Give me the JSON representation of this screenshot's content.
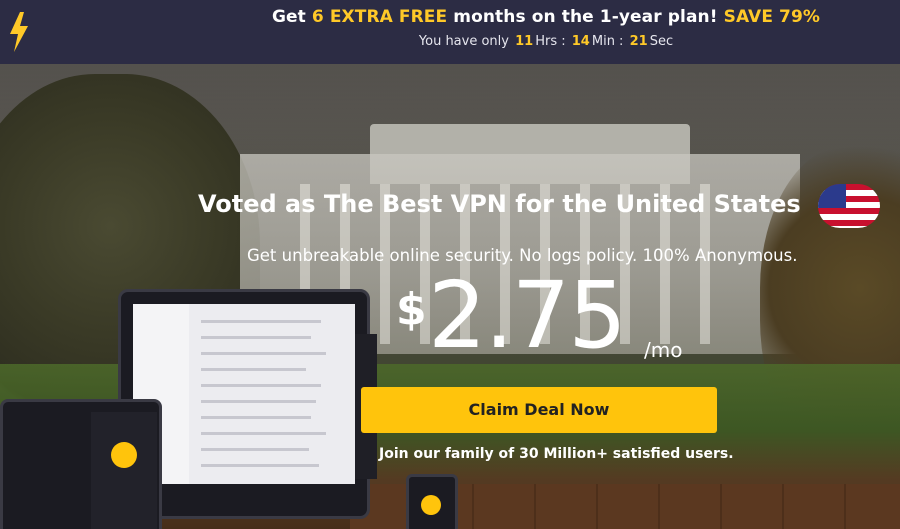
{
  "promo": {
    "get": "Get ",
    "extra": "6 EXTRA FREE",
    "middle": " months on the 1-year plan! ",
    "save": "SAVE 79%",
    "timer_prefix": "You have only",
    "hours": "11",
    "hours_label": "Hrs :",
    "minutes": "14",
    "minutes_label": "Min :",
    "seconds": "21",
    "seconds_label": "Sec"
  },
  "hero": {
    "headline": "Voted as The Best VPN for the United States",
    "subline": "Get unbreakable online security. No logs policy. 100% Anonymous.",
    "currency": "$",
    "price": "2.75",
    "period": "/mo",
    "cta_label": "Claim Deal Now",
    "social_proof": "Join our family of 30 Million+ satisfied users."
  },
  "icons": {
    "promo": "lightning-bolt-icon",
    "flag": "us-flag-icon"
  },
  "colors": {
    "accent": "#ffc40c",
    "promo_bg": "#2c2c44"
  }
}
